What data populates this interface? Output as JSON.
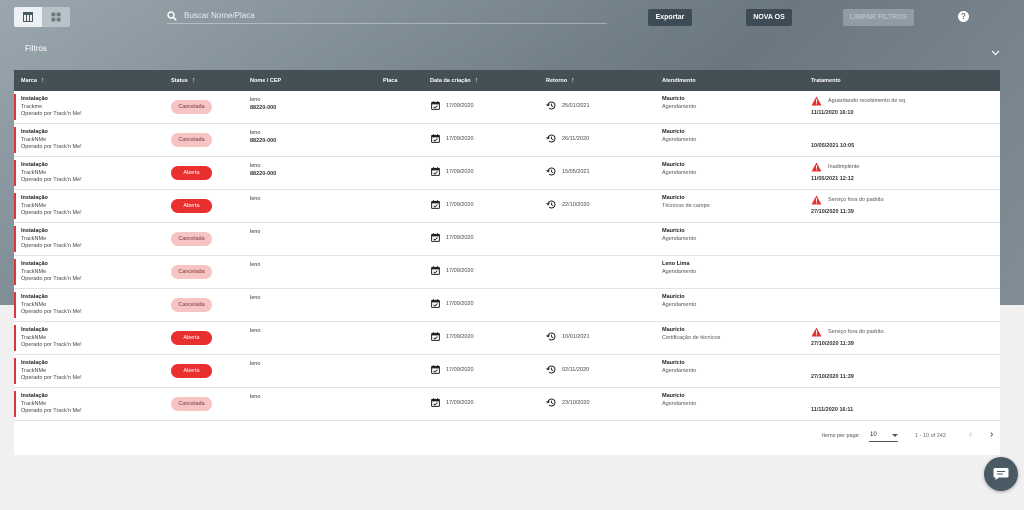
{
  "search": {
    "placeholder": "Buscar Nome/Placa"
  },
  "toolbar": {
    "export_label": "Exportar",
    "nova_os_label": "NOVA OS",
    "limpar_label": "LIMPAR FILTROS",
    "help_label": "?"
  },
  "filters": {
    "label": "Filtros"
  },
  "table": {
    "headers": {
      "marca": "Marca",
      "status": "Status",
      "nome": "Nome / CEP",
      "placa": "Placa",
      "criacao": "Data da criação",
      "retorno": "Retorno",
      "atendimento": "Atendimento",
      "tratamento": "Tratamento"
    },
    "rows": [
      {
        "marca": [
          "Instalação",
          "Trackme",
          "Operado por Track'n Me!"
        ],
        "status": "Cancelada",
        "status_kind": "c",
        "nome": "leno",
        "cep": "88220-000",
        "criacao": "17/09/2020",
        "retorno": "25/01/2021",
        "atend_nome": "Mauricio",
        "atend_sub": "Agendamento",
        "trat_msg": "Aguardando recebimento de eq",
        "trat_date": "11/11/2020 16:10"
      },
      {
        "marca": [
          "Instalação",
          "TrackNMe",
          "Operado por Track'n Me!"
        ],
        "status": "Cancelada",
        "status_kind": "c",
        "nome": "leno",
        "cep": "88220-000",
        "criacao": "17/09/2020",
        "retorno": "26/11/2020",
        "atend_nome": "Mauricio",
        "atend_sub": "Agendamento",
        "trat_msg": "",
        "trat_date": "10/05/2021 10:05"
      },
      {
        "marca": [
          "Instalação",
          "TrackNMe",
          "Operado por Track'n Me!"
        ],
        "status": "Aberta",
        "status_kind": "a",
        "nome": "leno",
        "cep": "88220-000",
        "criacao": "17/09/2020",
        "retorno": "15/05/2021",
        "atend_nome": "Mauricio",
        "atend_sub": "Agendamento",
        "trat_msg": "Inadimplente",
        "trat_date": "11/05/2021 12:12"
      },
      {
        "marca": [
          "Instalação",
          "TrackNMe",
          "Operado por Track'n Me!"
        ],
        "status": "Aberta",
        "status_kind": "a",
        "nome": "leno",
        "cep": "",
        "criacao": "17/09/2020",
        "retorno": "22/10/2020",
        "atend_nome": "Mauricio",
        "atend_sub": "Técnicos de campo",
        "trat_msg": "Serviço fora do padrão",
        "trat_date": "27/10/2020 11:39"
      },
      {
        "marca": [
          "Instalação",
          "TrackNMe",
          "Operado por Track'n Me!"
        ],
        "status": "Cancelada",
        "status_kind": "c",
        "nome": "leno",
        "cep": "",
        "criacao": "17/09/2020",
        "retorno": "",
        "atend_nome": "Mauricio",
        "atend_sub": "Agendamento",
        "trat_msg": "",
        "trat_date": ""
      },
      {
        "marca": [
          "Instalação",
          "TrackNMe",
          "Operado por Track'n Me!"
        ],
        "status": "Cancelada",
        "status_kind": "c",
        "nome": "leno",
        "cep": "",
        "criacao": "17/09/2020",
        "retorno": "",
        "atend_nome": "Leno Lima",
        "atend_sub": "Agendamento",
        "trat_msg": "",
        "trat_date": ""
      },
      {
        "marca": [
          "Instalação",
          "TrackNMe",
          "Operado por Track'n Me!"
        ],
        "status": "Cancelada",
        "status_kind": "c",
        "nome": "leno",
        "cep": "",
        "criacao": "17/09/2020",
        "retorno": "",
        "atend_nome": "Mauricio",
        "atend_sub": "Agendamento",
        "trat_msg": "",
        "trat_date": ""
      },
      {
        "marca": [
          "Instalação",
          "TrackNMe",
          "Operado por Track'n Me!"
        ],
        "status": "Aberta",
        "status_kind": "a",
        "nome": "leno",
        "cep": "",
        "criacao": "17/09/2020",
        "retorno": "10/01/2021",
        "atend_nome": "Mauricio",
        "atend_sub": "Certificação de técnicos",
        "trat_msg": "Serviço fora do padrão",
        "trat_date": "27/10/2020 11:39"
      },
      {
        "marca": [
          "Instalação",
          "TrackNMe",
          "Operado por Track'n Me!"
        ],
        "status": "Aberta",
        "status_kind": "a",
        "nome": "leno",
        "cep": "",
        "criacao": "17/09/2020",
        "retorno": "02/11/2020",
        "atend_nome": "Mauricio",
        "atend_sub": "Agendamento",
        "trat_msg": "",
        "trat_date": "27/10/2020 11:39"
      },
      {
        "marca": [
          "Instalação",
          "TrackNMe",
          "Operado por Track'n Me!"
        ],
        "status": "Cancelada",
        "status_kind": "c",
        "nome": "leno",
        "cep": "",
        "criacao": "17/09/2020",
        "retorno": "23/10/2020",
        "atend_nome": "Mauricio",
        "atend_sub": "Agendamento",
        "trat_msg": "",
        "trat_date": "11/11/2020 16:11"
      }
    ]
  },
  "pagination": {
    "items_label": "Items per page:",
    "page_size": "10",
    "range": "1 - 10 of 242"
  },
  "colors": {
    "header_bg": "#454f56",
    "accent_red": "#d9363e",
    "cancelada_bg": "#f7c4c4",
    "aberta_bg": "#e8302f"
  },
  "icons": [
    "table-view-icon",
    "grid-view-icon",
    "search-icon",
    "help-icon",
    "chevron-down-icon",
    "sort-arrow-icon",
    "calendar-icon",
    "history-icon",
    "warning-icon",
    "chevron-left-icon",
    "chevron-right-icon",
    "chat-icon"
  ]
}
